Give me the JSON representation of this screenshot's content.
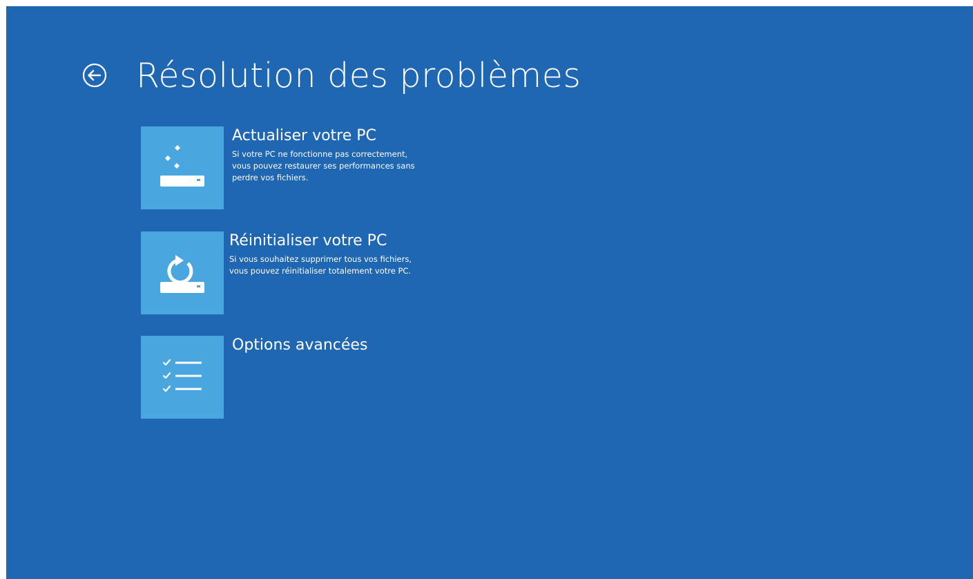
{
  "header": {
    "back_icon": "back-arrow-circle-icon",
    "title": "Résolution des problèmes"
  },
  "options": [
    {
      "icon": "refresh-pc-icon",
      "title": "Actualiser votre PC",
      "description": "Si votre PC ne fonctionne pas correctement, vous pouvez restaurer ses performances sans perdre vos fichiers."
    },
    {
      "icon": "reset-pc-icon",
      "title": "Réinitialiser votre PC",
      "description": "Si vous souhaitez supprimer tous vos fichiers, vous pouvez réinitialiser totalement votre PC."
    },
    {
      "icon": "checklist-icon",
      "title": "Options avancées",
      "description": ""
    }
  ],
  "colors": {
    "background": "#2067b3",
    "tile": "#4aa6de",
    "text": "#ffffff"
  }
}
